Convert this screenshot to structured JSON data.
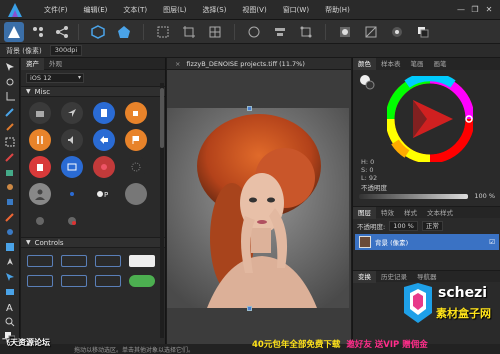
{
  "menubar": {
    "items": [
      "文件(F)",
      "编辑(E)",
      "文本(T)",
      "图层(L)",
      "选择(S)",
      "视图(V)",
      "窗口(W)",
      "帮助(H)"
    ],
    "window_controls": [
      "—",
      "❐",
      "✕"
    ]
  },
  "context": {
    "mode": "背景 (像素)",
    "dpi": "300dpi"
  },
  "assets": {
    "tabs": [
      "资产",
      "外观"
    ],
    "set": "iOS 12",
    "section_misc": "Misc",
    "section_controls": "Controls"
  },
  "document": {
    "title": "fizzyB_DENOISE projects.tiff (11.7%)",
    "close": "×"
  },
  "colors_panel": {
    "tabs": [
      "颜色",
      "样本表",
      "笔画",
      "画笔"
    ],
    "hsl": [
      "H: 0",
      "S: 0",
      "L: 92"
    ],
    "opacity_label": "不透明度",
    "opacity_value": "100 %"
  },
  "layers": {
    "tabs": [
      "图层",
      "特效",
      "样式",
      "文本样式"
    ],
    "opacity_label": "不透明度:",
    "opacity_value": "100 %",
    "blend_mode": "正常",
    "layer_name": "背景 (像素)"
  },
  "bottom_panels": {
    "tabs": [
      "变换",
      "历史记录",
      "导航器"
    ]
  },
  "status": {
    "hint": "拖动以移动选区。单击其他对象以选择它们。"
  },
  "watermarks": {
    "forum": "飞天资源论坛",
    "brand": "schezi",
    "brand_sub": "素材盒子网",
    "promo1": "40元包年全部免费下载",
    "promo2": "邀好友 送VIP 赠佣金"
  },
  "theme": {
    "accent": "#3b72c4",
    "promo_yellow": "#ffe31a",
    "promo_pink": "#ff2d8a"
  }
}
